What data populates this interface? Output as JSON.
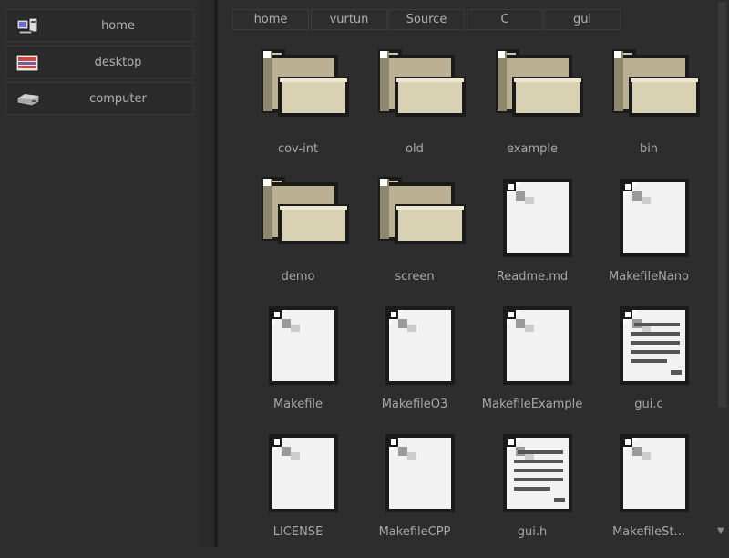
{
  "sidebar": {
    "items": [
      {
        "label": "home",
        "icon": "home-computer-icon"
      },
      {
        "label": "desktop",
        "icon": "desktop-icon"
      },
      {
        "label": "computer",
        "icon": "drive-icon"
      }
    ]
  },
  "breadcrumb": [
    "home",
    "vurtun",
    "Source",
    "C",
    "gui"
  ],
  "files": [
    {
      "name": "cov-int",
      "type": "folder"
    },
    {
      "name": "old",
      "type": "folder"
    },
    {
      "name": "example",
      "type": "folder"
    },
    {
      "name": "bin",
      "type": "folder"
    },
    {
      "name": "demo",
      "type": "folder"
    },
    {
      "name": "screen",
      "type": "folder"
    },
    {
      "name": "Readme.md",
      "type": "file"
    },
    {
      "name": "MakefileNano",
      "type": "file"
    },
    {
      "name": "Makefile",
      "type": "file"
    },
    {
      "name": "MakefileO3",
      "type": "file"
    },
    {
      "name": "MakefileExample",
      "type": "file"
    },
    {
      "name": "gui.c",
      "type": "text-file"
    },
    {
      "name": "LICENSE",
      "type": "file"
    },
    {
      "name": "MakefileCPP",
      "type": "file"
    },
    {
      "name": "gui.h",
      "type": "text-file"
    },
    {
      "name": "MakefileSt...",
      "type": "file"
    }
  ],
  "colors": {
    "background": "#2d2d2d",
    "folder_tan": "#cfc7a5",
    "file_white": "#f2f2f2",
    "outline": "#1a1a1a"
  }
}
